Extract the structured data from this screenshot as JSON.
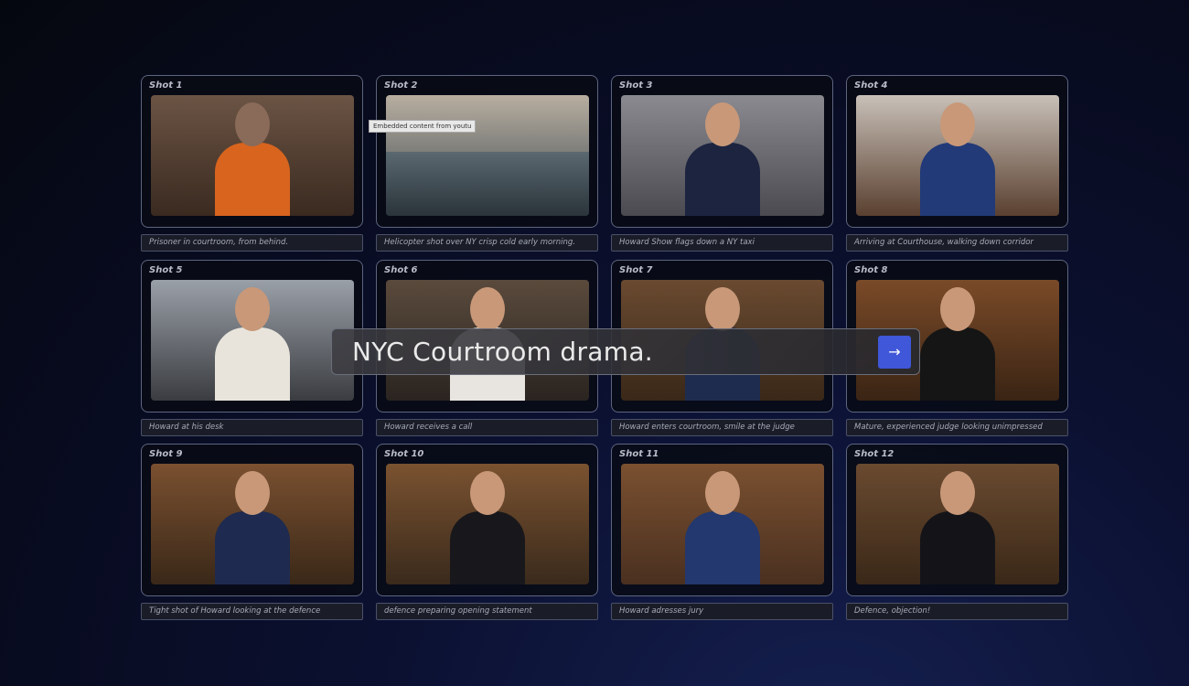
{
  "tooltip": "Embedded content from youtu",
  "prompt": {
    "text": "NYC Courtroom drama.",
    "submit_icon": "arrow-right-icon",
    "accent": "#3f57d8"
  },
  "shots": [
    {
      "label": "Shot 1",
      "caption": "Prisoner in courtroom, from behind.",
      "bg": [
        "#6b5444",
        "#3a2a20"
      ],
      "fig": "#d8641e"
    },
    {
      "label": "Shot 2",
      "caption": "Helicopter shot over NY crisp cold early morning.",
      "bg": [
        "#b8aea0",
        "#3c4850"
      ],
      "fig": ""
    },
    {
      "label": "Shot 3",
      "caption": "Howard Show flags down a NY taxi",
      "bg": [
        "#8a8a90",
        "#4a4a50"
      ],
      "fig": "#1c2440"
    },
    {
      "label": "Shot 4",
      "caption": "Arriving at Courthouse, walking down corridor",
      "bg": [
        "#c8c0b8",
        "#5a4030"
      ],
      "fig": "#223a78"
    },
    {
      "label": "Shot 5",
      "caption": "Howard at his desk",
      "bg": [
        "#9aa0a8",
        "#3a3c40"
      ],
      "fig": "#e8e4dc"
    },
    {
      "label": "Shot 6",
      "caption": "Howard receives a call",
      "bg": [
        "#5a4a3c",
        "#2a2420"
      ],
      "fig": "#e8e4e0"
    },
    {
      "label": "Shot 7",
      "caption": "Howard enters courtroom, smile at the judge",
      "bg": [
        "#6a4a30",
        "#3a2818"
      ],
      "fig": "#1e2c50"
    },
    {
      "label": "Shot 8",
      "caption": "Mature, experienced judge looking unimpressed",
      "bg": [
        "#7a4a28",
        "#3a2414"
      ],
      "fig": "#151515"
    },
    {
      "label": "Shot 9",
      "caption": "Tight shot of Howard looking at the defence",
      "bg": [
        "#7a5030",
        "#3a2818"
      ],
      "fig": "#1e2a50"
    },
    {
      "label": "Shot 10",
      "caption": "defence preparing opening statement",
      "bg": [
        "#7a5230",
        "#3a2a1c"
      ],
      "fig": "#18181c"
    },
    {
      "label": "Shot 11",
      "caption": "Howard adresses jury",
      "bg": [
        "#7a5030",
        "#4a3020"
      ],
      "fig": "#22386e"
    },
    {
      "label": "Shot 12",
      "caption": "Defence, objection!",
      "bg": [
        "#6a4a30",
        "#3a2818"
      ],
      "fig": "#141418"
    }
  ]
}
